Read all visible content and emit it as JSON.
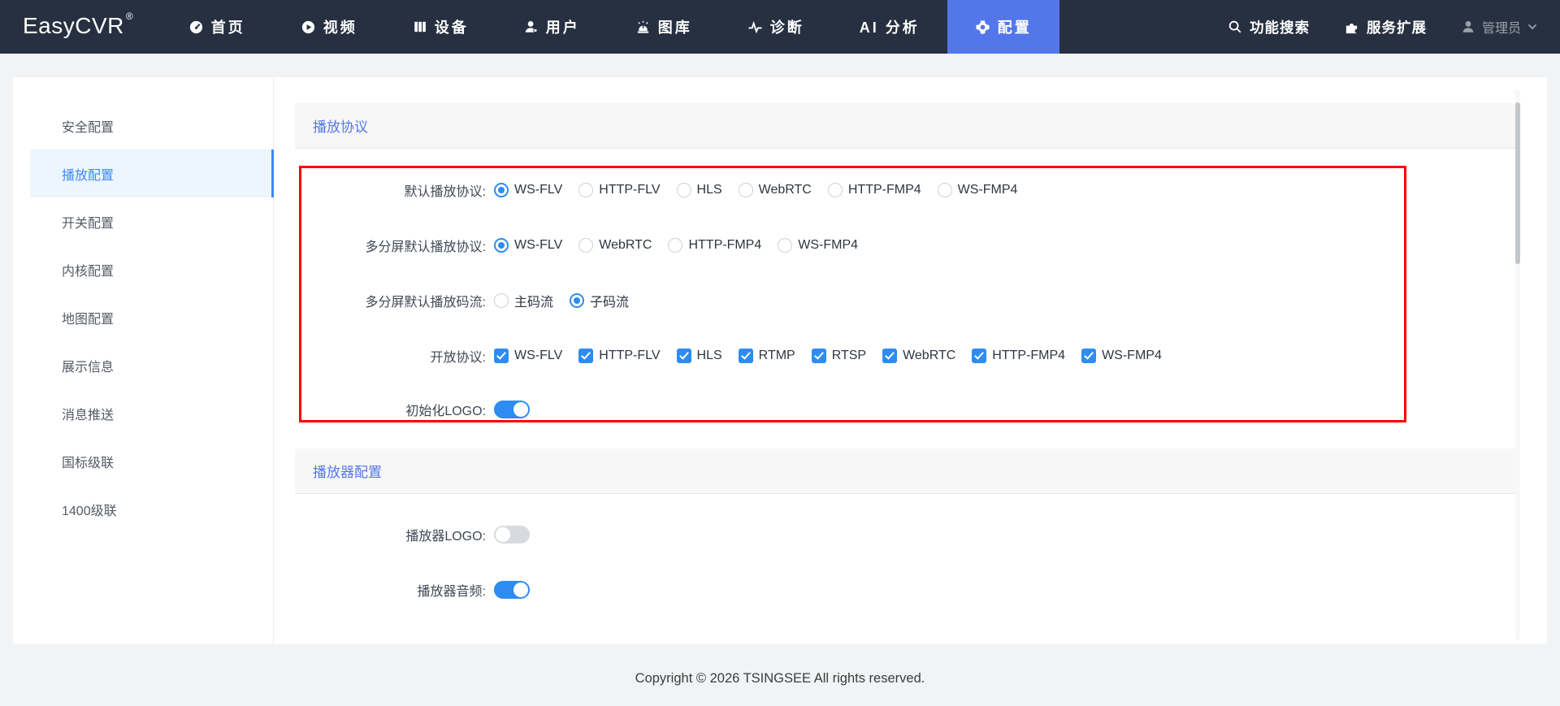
{
  "navbar": {
    "logo": "EasyCVR",
    "logo_mark": "®",
    "items": [
      {
        "label": "首页",
        "active": false
      },
      {
        "label": "视频",
        "active": false
      },
      {
        "label": "设备",
        "active": false
      },
      {
        "label": "用户",
        "active": false
      },
      {
        "label": "图库",
        "active": false
      },
      {
        "label": "诊断",
        "active": false
      },
      {
        "label": "AI 分析",
        "active": false
      },
      {
        "label": "配置",
        "active": true
      }
    ],
    "search_label": "功能搜索",
    "extension_label": "服务扩展",
    "user_label": "管理员",
    "icons": [
      "dashboard-icon",
      "play-icon",
      "device-icon",
      "user-icon",
      "alarm-icon",
      "pulse-icon",
      "gear-icon",
      "search-icon",
      "puzzle-icon",
      "person-icon",
      "chevron-down-icon"
    ]
  },
  "sidebar": {
    "items": [
      {
        "label": "安全配置",
        "active": false
      },
      {
        "label": "播放配置",
        "active": true
      },
      {
        "label": "开关配置",
        "active": false
      },
      {
        "label": "内核配置",
        "active": false
      },
      {
        "label": "地图配置",
        "active": false
      },
      {
        "label": "展示信息",
        "active": false
      },
      {
        "label": "消息推送",
        "active": false
      },
      {
        "label": "国标级联",
        "active": false
      },
      {
        "label": "1400级联",
        "active": false
      }
    ]
  },
  "main": {
    "sections": [
      {
        "title": "播放协议",
        "rows": [
          {
            "label": "默认播放协议:",
            "type": "radio",
            "options": [
              {
                "label": "WS-FLV",
                "checked": true
              },
              {
                "label": "HTTP-FLV",
                "checked": false
              },
              {
                "label": "HLS",
                "checked": false
              },
              {
                "label": "WebRTC",
                "checked": false
              },
              {
                "label": "HTTP-FMP4",
                "checked": false
              },
              {
                "label": "WS-FMP4",
                "checked": false
              }
            ]
          },
          {
            "label": "多分屏默认播放协议:",
            "type": "radio",
            "options": [
              {
                "label": "WS-FLV",
                "checked": true
              },
              {
                "label": "WebRTC",
                "checked": false
              },
              {
                "label": "HTTP-FMP4",
                "checked": false
              },
              {
                "label": "WS-FMP4",
                "checked": false
              }
            ]
          },
          {
            "label": "多分屏默认播放码流:",
            "type": "radio",
            "options": [
              {
                "label": "主码流",
                "checked": false
              },
              {
                "label": "子码流",
                "checked": true
              }
            ]
          },
          {
            "label": "开放协议:",
            "type": "checkbox",
            "options": [
              {
                "label": "WS-FLV",
                "checked": true
              },
              {
                "label": "HTTP-FLV",
                "checked": true
              },
              {
                "label": "HLS",
                "checked": true
              },
              {
                "label": "RTMP",
                "checked": true
              },
              {
                "label": "RTSP",
                "checked": true
              },
              {
                "label": "WebRTC",
                "checked": true
              },
              {
                "label": "HTTP-FMP4",
                "checked": true
              },
              {
                "label": "WS-FMP4",
                "checked": true
              }
            ]
          },
          {
            "label": "初始化LOGO:",
            "type": "switch",
            "on": true
          }
        ]
      },
      {
        "title": "播放器配置",
        "rows": [
          {
            "label": "播放器LOGO:",
            "type": "switch",
            "on": false
          },
          {
            "label": "播放器音频:",
            "type": "switch",
            "on": true
          }
        ]
      }
    ]
  },
  "footer": {
    "copyright": "Copyright © 2026 TSINGSEE All rights reserved."
  },
  "colors": {
    "accent": "#5377ea",
    "control": "#2d8cf0",
    "sidebar_active": "#3d8af5",
    "annotation": "#fe0000",
    "navbar_bg": "#273040"
  }
}
